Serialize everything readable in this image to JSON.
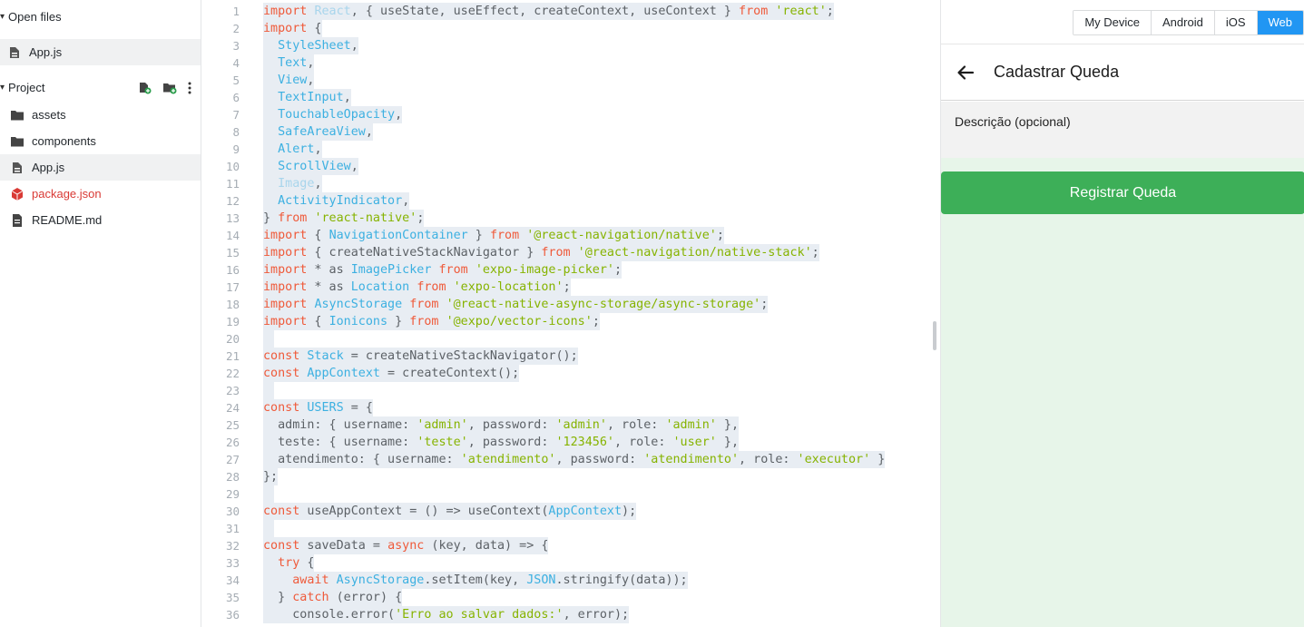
{
  "sidebar": {
    "open_files_label": "Open files",
    "open_files": [
      {
        "name": "App.js"
      }
    ],
    "project_label": "Project",
    "tree": [
      {
        "name": "assets",
        "type": "folder"
      },
      {
        "name": "components",
        "type": "folder"
      },
      {
        "name": "App.js",
        "type": "file"
      },
      {
        "name": "package.json",
        "type": "package"
      },
      {
        "name": "README.md",
        "type": "doc"
      }
    ]
  },
  "editor": {
    "line_numbers": [
      "1",
      "2",
      "3",
      "4",
      "5",
      "6",
      "7",
      "8",
      "9",
      "10",
      "11",
      "12",
      "13",
      "14",
      "15",
      "16",
      "17",
      "18",
      "19",
      "20",
      "21",
      "22",
      "23",
      "24",
      "25",
      "26",
      "27",
      "28",
      "29",
      "30",
      "31",
      "32",
      "33",
      "34",
      "35",
      "36"
    ],
    "lines": [
      [
        [
          "kw",
          "import"
        ],
        [
          "pl",
          " "
        ],
        [
          "dim",
          "React"
        ],
        [
          "pl",
          ", { useState, useEffect, createContext, useContext } "
        ],
        [
          "kw",
          "from"
        ],
        [
          "pl",
          " "
        ],
        [
          "str",
          "'react'"
        ],
        [
          "pl",
          ";"
        ]
      ],
      [
        [
          "kw",
          "import"
        ],
        [
          "pl",
          " {"
        ]
      ],
      [
        [
          "pl",
          "  "
        ],
        [
          "id",
          "StyleSheet"
        ],
        [
          "pl",
          ","
        ]
      ],
      [
        [
          "pl",
          "  "
        ],
        [
          "id",
          "Text"
        ],
        [
          "pl",
          ","
        ]
      ],
      [
        [
          "pl",
          "  "
        ],
        [
          "id",
          "View"
        ],
        [
          "pl",
          ","
        ]
      ],
      [
        [
          "pl",
          "  "
        ],
        [
          "id",
          "TextInput"
        ],
        [
          "pl",
          ","
        ]
      ],
      [
        [
          "pl",
          "  "
        ],
        [
          "id",
          "TouchableOpacity"
        ],
        [
          "pl",
          ","
        ]
      ],
      [
        [
          "pl",
          "  "
        ],
        [
          "id",
          "SafeAreaView"
        ],
        [
          "pl",
          ","
        ]
      ],
      [
        [
          "pl",
          "  "
        ],
        [
          "id",
          "Alert"
        ],
        [
          "pl",
          ","
        ]
      ],
      [
        [
          "pl",
          "  "
        ],
        [
          "id",
          "ScrollView"
        ],
        [
          "pl",
          ","
        ]
      ],
      [
        [
          "pl",
          "  "
        ],
        [
          "dim",
          "Image"
        ],
        [
          "pl",
          ","
        ]
      ],
      [
        [
          "pl",
          "  "
        ],
        [
          "id",
          "ActivityIndicator"
        ],
        [
          "pl",
          ","
        ]
      ],
      [
        [
          "pl",
          "} "
        ],
        [
          "kw",
          "from"
        ],
        [
          "pl",
          " "
        ],
        [
          "str",
          "'react-native'"
        ],
        [
          "pl",
          ";"
        ]
      ],
      [
        [
          "kw",
          "import"
        ],
        [
          "pl",
          " { "
        ],
        [
          "id",
          "NavigationContainer"
        ],
        [
          "pl",
          " } "
        ],
        [
          "kw",
          "from"
        ],
        [
          "pl",
          " "
        ],
        [
          "str",
          "'@react-navigation/native'"
        ],
        [
          "pl",
          ";"
        ]
      ],
      [
        [
          "kw",
          "import"
        ],
        [
          "pl",
          " { createNativeStackNavigator } "
        ],
        [
          "kw",
          "from"
        ],
        [
          "pl",
          " "
        ],
        [
          "str",
          "'@react-navigation/native-stack'"
        ],
        [
          "pl",
          ";"
        ]
      ],
      [
        [
          "kw",
          "import"
        ],
        [
          "pl",
          " * as "
        ],
        [
          "id",
          "ImagePicker"
        ],
        [
          "pl",
          " "
        ],
        [
          "kw",
          "from"
        ],
        [
          "pl",
          " "
        ],
        [
          "str",
          "'expo-image-picker'"
        ],
        [
          "pl",
          ";"
        ]
      ],
      [
        [
          "kw",
          "import"
        ],
        [
          "pl",
          " * as "
        ],
        [
          "id",
          "Location"
        ],
        [
          "pl",
          " "
        ],
        [
          "kw",
          "from"
        ],
        [
          "pl",
          " "
        ],
        [
          "str",
          "'expo-location'"
        ],
        [
          "pl",
          ";"
        ]
      ],
      [
        [
          "kw",
          "import"
        ],
        [
          "pl",
          " "
        ],
        [
          "id",
          "AsyncStorage"
        ],
        [
          "pl",
          " "
        ],
        [
          "kw",
          "from"
        ],
        [
          "pl",
          " "
        ],
        [
          "str",
          "'@react-native-async-storage/async-storage'"
        ],
        [
          "pl",
          ";"
        ]
      ],
      [
        [
          "kw",
          "import"
        ],
        [
          "pl",
          " { "
        ],
        [
          "id",
          "Ionicons"
        ],
        [
          "pl",
          " } "
        ],
        [
          "kw",
          "from"
        ],
        [
          "pl",
          " "
        ],
        [
          "str",
          "'@expo/vector-icons'"
        ],
        [
          "pl",
          ";"
        ]
      ],
      [],
      [
        [
          "kw",
          "const"
        ],
        [
          "pl",
          " "
        ],
        [
          "id",
          "Stack"
        ],
        [
          "pl",
          " = createNativeStackNavigator();"
        ]
      ],
      [
        [
          "kw",
          "const"
        ],
        [
          "pl",
          " "
        ],
        [
          "id",
          "AppContext"
        ],
        [
          "pl",
          " = createContext();"
        ]
      ],
      [],
      [
        [
          "kw",
          "const"
        ],
        [
          "pl",
          " "
        ],
        [
          "id",
          "USERS"
        ],
        [
          "pl",
          " = {"
        ]
      ],
      [
        [
          "pl",
          "  admin: { username: "
        ],
        [
          "str",
          "'admin'"
        ],
        [
          "pl",
          ", password: "
        ],
        [
          "str",
          "'admin'"
        ],
        [
          "pl",
          ", role: "
        ],
        [
          "str",
          "'admin'"
        ],
        [
          "pl",
          " },"
        ]
      ],
      [
        [
          "pl",
          "  teste: { username: "
        ],
        [
          "str",
          "'teste'"
        ],
        [
          "pl",
          ", password: "
        ],
        [
          "str",
          "'123456'"
        ],
        [
          "pl",
          ", role: "
        ],
        [
          "str",
          "'user'"
        ],
        [
          "pl",
          " },"
        ]
      ],
      [
        [
          "pl",
          "  atendimento: { username: "
        ],
        [
          "str",
          "'atendimento'"
        ],
        [
          "pl",
          ", password: "
        ],
        [
          "str",
          "'atendimento'"
        ],
        [
          "pl",
          ", role: "
        ],
        [
          "str",
          "'executor'"
        ],
        [
          "pl",
          " }"
        ]
      ],
      [
        [
          "pl",
          "};"
        ]
      ],
      [],
      [
        [
          "kw",
          "const"
        ],
        [
          "pl",
          " useAppContext = () => useContext("
        ],
        [
          "id",
          "AppContext"
        ],
        [
          "pl",
          ");"
        ]
      ],
      [],
      [
        [
          "kw",
          "const"
        ],
        [
          "pl",
          " saveData = "
        ],
        [
          "kw",
          "async"
        ],
        [
          "pl",
          " (key, data) => {"
        ]
      ],
      [
        [
          "pl",
          "  "
        ],
        [
          "kw",
          "try"
        ],
        [
          "pl",
          " {"
        ]
      ],
      [
        [
          "pl",
          "    "
        ],
        [
          "kw",
          "await"
        ],
        [
          "pl",
          " "
        ],
        [
          "id",
          "AsyncStorage"
        ],
        [
          "pl",
          ".setItem(key, "
        ],
        [
          "id",
          "JSON"
        ],
        [
          "pl",
          ".stringify(data));"
        ]
      ],
      [
        [
          "pl",
          "  } "
        ],
        [
          "kw",
          "catch"
        ],
        [
          "pl",
          " (error) {"
        ]
      ],
      [
        [
          "pl",
          "    console.error("
        ],
        [
          "str",
          "'Erro ao salvar dados:'"
        ],
        [
          "pl",
          ", error);"
        ]
      ]
    ]
  },
  "preview": {
    "platforms": [
      "My Device",
      "Android",
      "iOS",
      "Web"
    ],
    "selected_platform": "Web",
    "screen_title": "Cadastrar Queda",
    "description_label": "Descrição (opcional)",
    "submit_label": "Registrar Queda",
    "colors": {
      "accent": "#2196f3",
      "button": "#3daf58",
      "background": "#e7f5e9"
    }
  }
}
